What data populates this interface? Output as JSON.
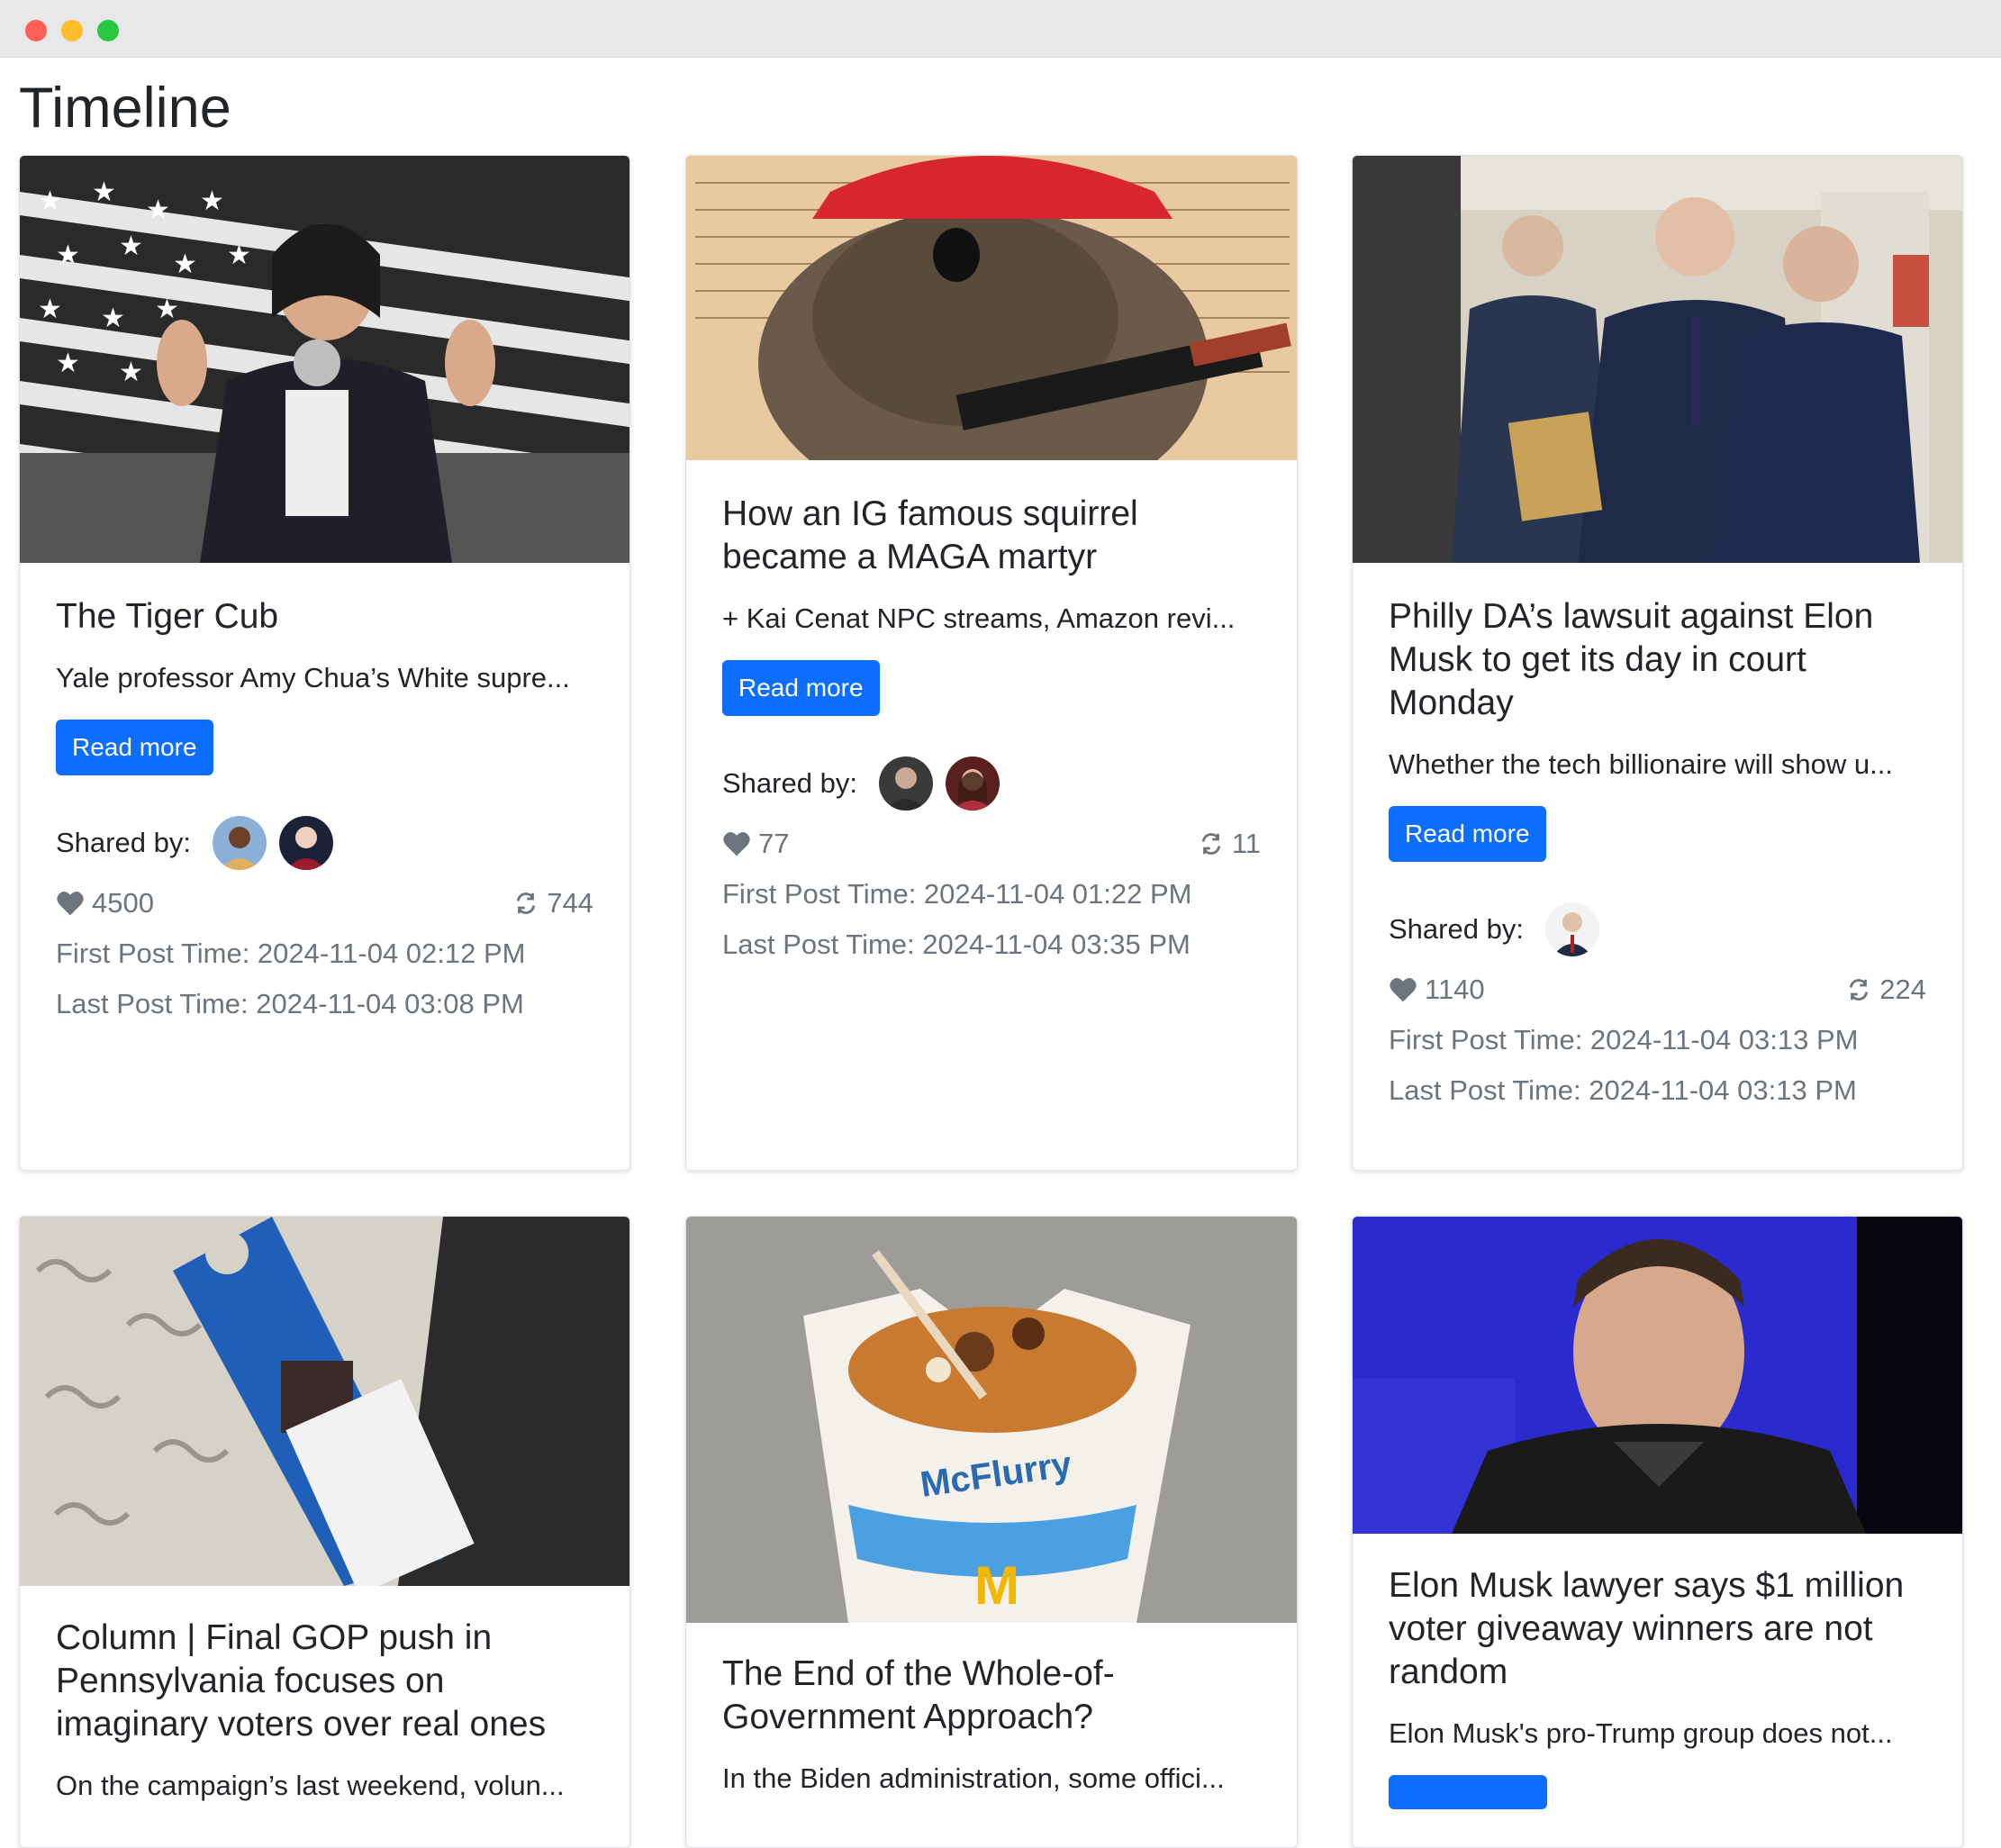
{
  "page": {
    "title": "Timeline"
  },
  "cards": [
    {
      "title": "The Tiger Cub",
      "snippet": "Yale professor Amy Chua’s White supre...",
      "button": "Read more",
      "shared_label": "Shared by:",
      "likes": "4500",
      "reposts": "744",
      "first_post": "First Post Time: 2024-11-04 02:12 PM",
      "last_post": "Last Post Time: 2024-11-04 03:08 PM"
    },
    {
      "title": "How an IG famous squirrel became a MAGA martyr",
      "snippet": "+ Kai Cenat NPC streams, Amazon revi...",
      "button": "Read more",
      "shared_label": "Shared by:",
      "likes": "77",
      "reposts": "11",
      "first_post": "First Post Time: 2024-11-04 01:22 PM",
      "last_post": "Last Post Time: 2024-11-04 03:35 PM"
    },
    {
      "title": "Philly DA’s lawsuit against Elon Musk to get its day in court Monday",
      "snippet": "Whether the tech billionaire will show u...",
      "button": "Read more",
      "shared_label": "Shared by:",
      "likes": "1140",
      "reposts": "224",
      "first_post": "First Post Time: 2024-11-04 03:13 PM",
      "last_post": "Last Post Time: 2024-11-04 03:13 PM"
    },
    {
      "title": "Column | Final GOP push in Pennsylvania focuses on imaginary voters over real ones",
      "snippet": "On the campaign’s last weekend, volun..."
    },
    {
      "title": "The End of the Whole-of-Government Approach?",
      "snippet": "In the Biden administration, some offici..."
    },
    {
      "title": "Elon Musk lawyer says $1 million voter giveaway winners are not random",
      "snippet": "Elon Musk's pro-Trump group does not..."
    }
  ]
}
